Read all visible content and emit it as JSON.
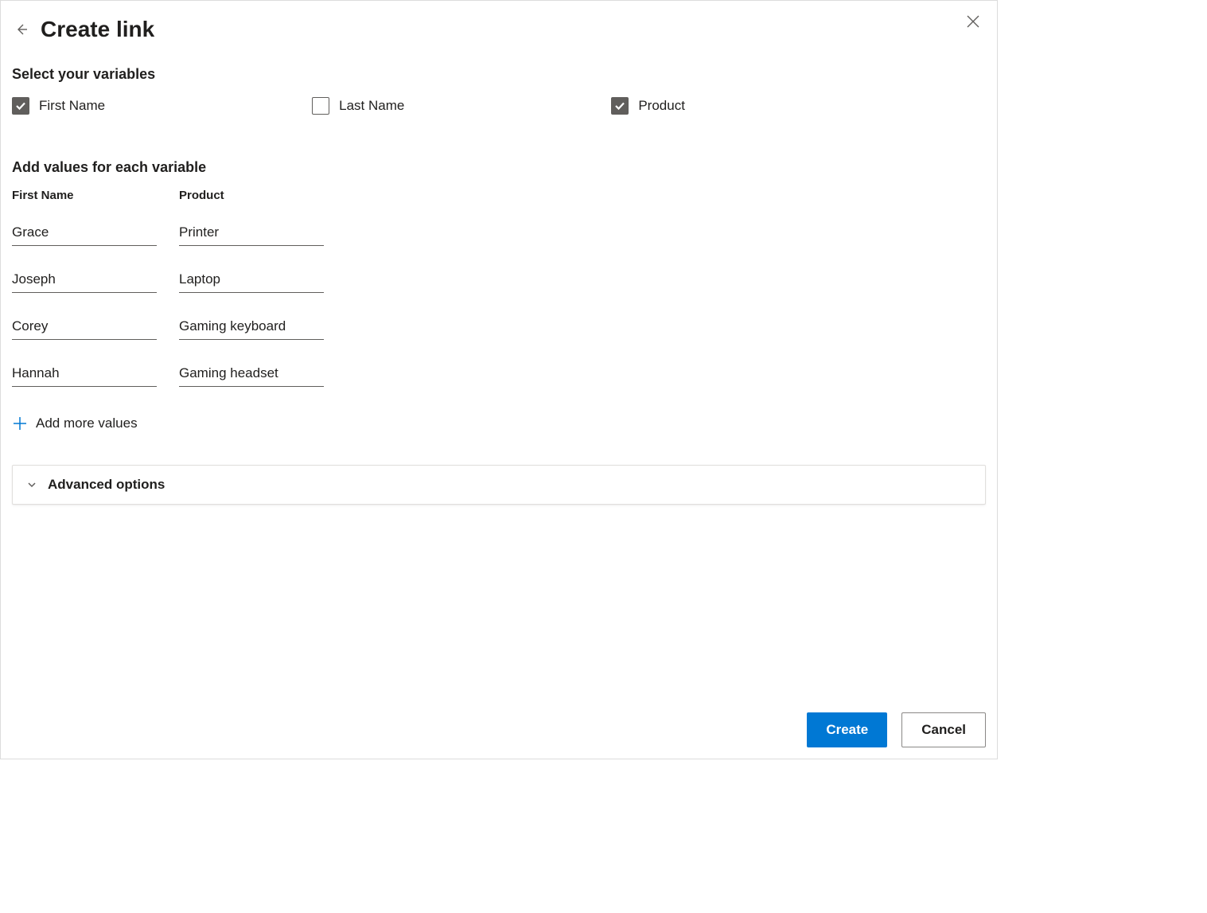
{
  "header": {
    "title": "Create link"
  },
  "variables": {
    "section_label": "Select your variables",
    "items": [
      {
        "label": "First Name",
        "checked": true
      },
      {
        "label": "Last Name",
        "checked": false
      },
      {
        "label": "Product",
        "checked": true
      }
    ]
  },
  "values": {
    "section_label": "Add values for each variable",
    "columns": [
      "First Name",
      "Product"
    ],
    "rows": [
      {
        "c0": "Grace",
        "c1": "Printer"
      },
      {
        "c0": "Joseph",
        "c1": "Laptop"
      },
      {
        "c0": "Corey",
        "c1": "Gaming keyboard"
      },
      {
        "c0": "Hannah",
        "c1": "Gaming headset"
      }
    ],
    "add_more_label": "Add more values"
  },
  "advanced": {
    "label": "Advanced options"
  },
  "footer": {
    "create_label": "Create",
    "cancel_label": "Cancel"
  }
}
